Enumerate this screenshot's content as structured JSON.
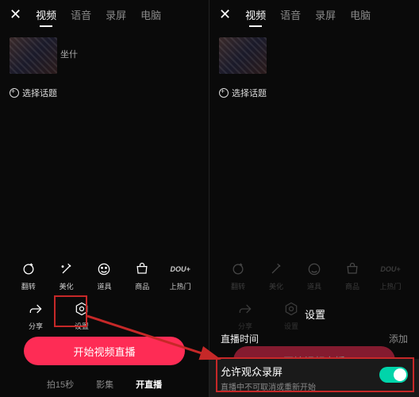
{
  "left": {
    "tabs": [
      "视频",
      "语音",
      "录屏",
      "电脑"
    ],
    "activeTab": 0,
    "previewLabel": "坐什",
    "topic": "选择话题",
    "tools_r1": [
      {
        "name": "flip-icon",
        "label": "翻转"
      },
      {
        "name": "beauty-icon",
        "label": "美化"
      },
      {
        "name": "props-icon",
        "label": "道具"
      },
      {
        "name": "goods-icon",
        "label": "商品"
      },
      {
        "name": "dou-icon",
        "label": "上热门"
      }
    ],
    "tools_r2": [
      {
        "name": "share-icon",
        "label": "分享"
      },
      {
        "name": "settings-icon",
        "label": "设置"
      }
    ],
    "startBtn": "开始视频直播",
    "bottomTabs": [
      "拍15秒",
      "影集",
      "开直播"
    ],
    "bottomActive": 2
  },
  "right": {
    "tabs": [
      "视频",
      "语音",
      "录屏",
      "电脑"
    ],
    "activeTab": 0,
    "topic": "选择话题",
    "tools_r1": [
      {
        "name": "flip-icon",
        "label": "翻转"
      },
      {
        "name": "beauty-icon",
        "label": "美化"
      },
      {
        "name": "props-icon",
        "label": "道具"
      },
      {
        "name": "goods-icon",
        "label": "商品"
      },
      {
        "name": "dou-icon",
        "label": "上热门"
      }
    ],
    "tools_r2": [
      {
        "name": "share-icon",
        "label": "分享"
      },
      {
        "name": "settings-icon",
        "label": "设置"
      }
    ],
    "settingsLabel": "设置",
    "sheetTitle": "直播时间",
    "sheetAdd": "添加",
    "startBtn": "开始视频直播",
    "setting": {
      "title": "允许观众录屏",
      "desc": "直播中不可取消或重新开始"
    }
  }
}
